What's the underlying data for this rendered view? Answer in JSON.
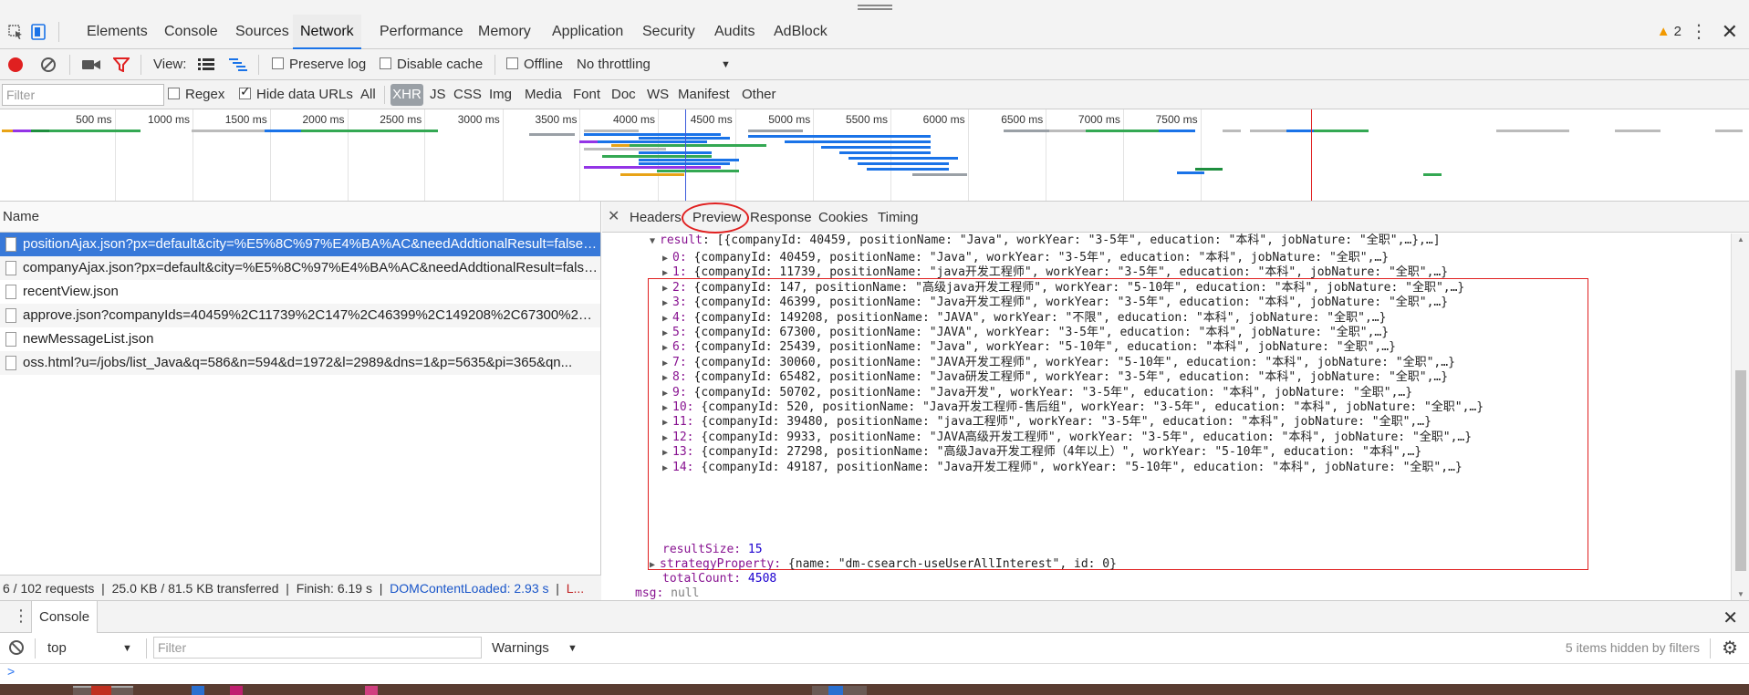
{
  "devtools": {
    "tabs": [
      "Elements",
      "Console",
      "Sources",
      "Network",
      "Performance",
      "Memory",
      "Application",
      "Security",
      "Audits",
      "AdBlock"
    ],
    "active_tab": "Network",
    "warning_count": "2"
  },
  "toolbar": {
    "view_label": "View:",
    "preserve_log": "Preserve log",
    "disable_cache": "Disable cache",
    "offline": "Offline",
    "throttling": "No throttling"
  },
  "filter_bar": {
    "placeholder": "Filter",
    "regex": "Regex",
    "hide_data_urls": "Hide data URLs",
    "types": [
      "All",
      "XHR",
      "JS",
      "CSS",
      "Img",
      "Media",
      "Font",
      "Doc",
      "WS",
      "Manifest",
      "Other"
    ],
    "active_type": "XHR"
  },
  "overview": {
    "ticks": [
      "500 ms",
      "1000 ms",
      "1500 ms",
      "2000 ms",
      "2500 ms",
      "3000 ms",
      "3500 ms",
      "4000 ms",
      "4500 ms",
      "5000 ms",
      "5500 ms",
      "6000 ms",
      "6500 ms",
      "7000 ms",
      "7500 ms"
    ]
  },
  "requests": {
    "header": "Name",
    "items": [
      "positionAjax.json?px=default&city=%E5%8C%97%E4%BA%AC&needAddtionalResult=false&...",
      "companyAjax.json?px=default&city=%E5%8C%97%E4%BA%AC&needAddtionalResult=false...",
      "recentView.json",
      "approve.json?companyIds=40459%2C11739%2C147%2C46399%2C149208%2C67300%2C25...",
      "newMessageList.json",
      "oss.html?u=/jobs/list_Java&q=586&n=594&d=1972&l=2989&dns=1&p=5635&pi=365&qn..."
    ]
  },
  "status_bar": {
    "requests": "6 / 102 requests",
    "transferred": "25.0 KB / 81.5 KB transferred",
    "finish": "Finish: 6.19 s",
    "dom_loaded": "DOMContentLoaded: 2.93 s",
    "load": "L..."
  },
  "detail_tabs": [
    "Headers",
    "Preview",
    "Response",
    "Cookies",
    "Timing"
  ],
  "active_detail_tab": "Preview",
  "preview": {
    "result_key": "result",
    "result_summary": "[{companyId: 40459, positionName: \"Java\", workYear: \"3-5年\", education: \"本科\", jobNature: \"全职\",…},…]",
    "items": [
      {
        "idx": "0:",
        "text": "{companyId: 40459, positionName: \"Java\", workYear: \"3-5年\", education: \"本科\", jobNature: \"全职\",…}"
      },
      {
        "idx": "1:",
        "text": "{companyId: 11739, positionName: \"java开发工程师\", workYear: \"3-5年\", education: \"本科\", jobNature: \"全职\",…}"
      },
      {
        "idx": "2:",
        "text": "{companyId: 147, positionName: \"高级java开发工程师\", workYear: \"5-10年\", education: \"本科\", jobNature: \"全职\",…}"
      },
      {
        "idx": "3:",
        "text": "{companyId: 46399, positionName: \"Java开发工程师\", workYear: \"3-5年\", education: \"本科\", jobNature: \"全职\",…}"
      },
      {
        "idx": "4:",
        "text": "{companyId: 149208, positionName: \"JAVA\", workYear: \"不限\", education: \"本科\", jobNature: \"全职\",…}"
      },
      {
        "idx": "5:",
        "text": "{companyId: 67300, positionName: \"JAVA\", workYear: \"3-5年\", education: \"本科\", jobNature: \"全职\",…}"
      },
      {
        "idx": "6:",
        "text": "{companyId: 25439, positionName: \"Java\", workYear: \"5-10年\", education: \"本科\", jobNature: \"全职\",…}"
      },
      {
        "idx": "7:",
        "text": "{companyId: 30060, positionName: \"JAVA开发工程师\", workYear: \"5-10年\", education: \"本科\", jobNature: \"全职\",…}"
      },
      {
        "idx": "8:",
        "text": "{companyId: 65482, positionName: \"Java研发工程师\", workYear: \"3-5年\", education: \"本科\", jobNature: \"全职\",…}"
      },
      {
        "idx": "9:",
        "text": "{companyId: 50702, positionName: \"Java开发\", workYear: \"3-5年\", education: \"本科\", jobNature: \"全职\",…}"
      },
      {
        "idx": "10:",
        "text": "{companyId: 520, positionName: \"Java开发工程师-售后组\", workYear: \"3-5年\", education: \"本科\", jobNature: \"全职\",…}"
      },
      {
        "idx": "11:",
        "text": "{companyId: 39480, positionName: \"java工程师\", workYear: \"3-5年\", education: \"本科\", jobNature: \"全职\",…}"
      },
      {
        "idx": "12:",
        "text": "{companyId: 9933, positionName: \"JAVA高级开发工程师\", workYear: \"3-5年\", education: \"本科\", jobNature: \"全职\",…}"
      },
      {
        "idx": "13:",
        "text": "{companyId: 27298, positionName: \"高级Java开发工程师（4年以上）\", workYear: \"5-10年\", education: \"本科\",…}"
      },
      {
        "idx": "14:",
        "text": "{companyId: 49187, positionName: \"Java开发工程师\", workYear: \"5-10年\", education: \"本科\", jobNature: \"全职\",…}"
      }
    ],
    "result_size_key": "resultSize:",
    "result_size": "15",
    "strategy_key": "strategyProperty:",
    "strategy_value": "{name: \"dm-csearch-useUserAllInterest\", id: 0}",
    "total_count_key": "totalCount:",
    "total_count": "4508",
    "msg_key": "msg:",
    "msg": "null"
  },
  "console": {
    "tab_label": "Console",
    "context": "top",
    "filter_placeholder": "Filter",
    "level": "Warnings",
    "hidden_note": "5 items hidden by filters",
    "prompt": ">"
  },
  "colors": {
    "accent": "#1a73e8",
    "selected_row": "#3879d9",
    "highlight_box": "#e02020",
    "json_key": "#881391",
    "json_number": "#1c00cf"
  }
}
